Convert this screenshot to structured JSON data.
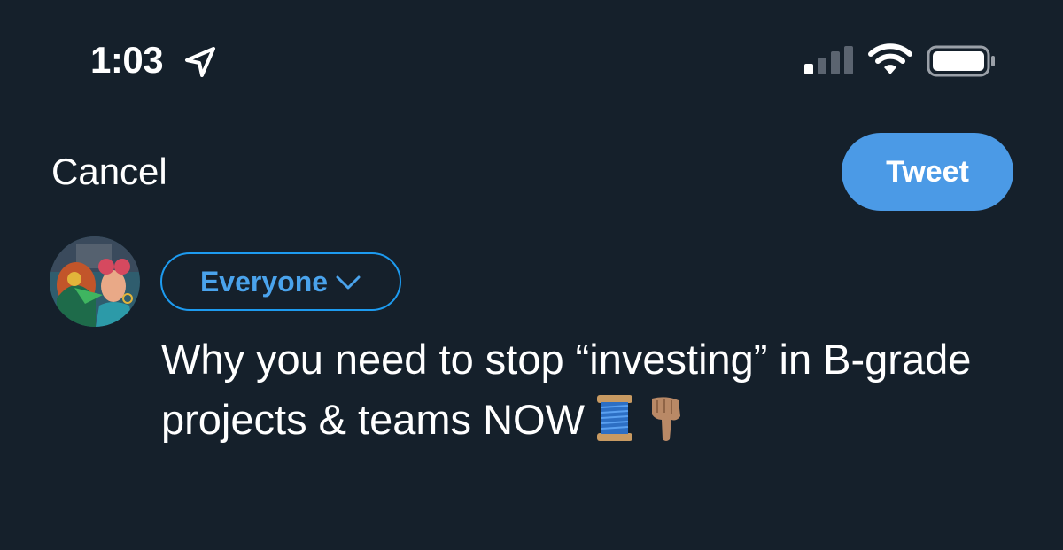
{
  "status_bar": {
    "time": "1:03",
    "icons": [
      "location-arrow-icon",
      "cellular-signal-icon",
      "wifi-icon",
      "battery-icon"
    ]
  },
  "header": {
    "cancel_label": "Cancel",
    "tweet_label": "Tweet"
  },
  "composer": {
    "audience_label": "Everyone",
    "text": "Why you need to stop “investing” in B-grade projects & teams NOW",
    "emojis": [
      "spool-of-thread-icon",
      "pointing-down-hand-icon"
    ]
  },
  "colors": {
    "background": "#15202b",
    "accent": "#4b9ae6",
    "audience_border": "#1d9bf0",
    "text": "#ffffff"
  }
}
